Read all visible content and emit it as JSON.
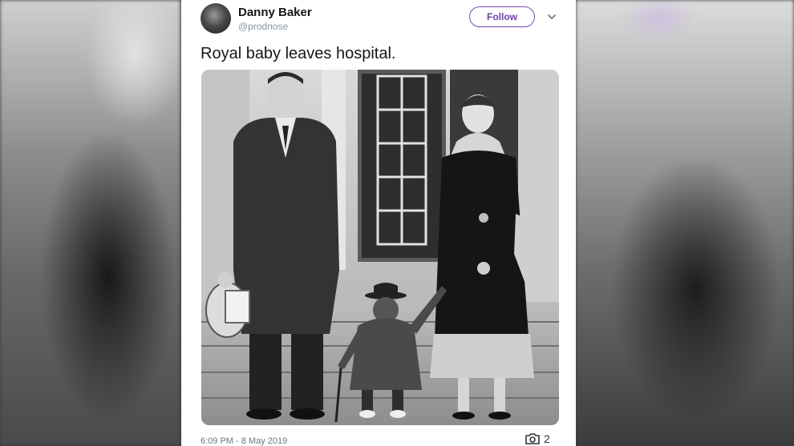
{
  "tweet": {
    "author": {
      "display_name": "Danny Baker",
      "handle": "@prodnose"
    },
    "follow_label": "Follow",
    "text": "Royal baby leaves hospital.",
    "timestamp": "6:09 PM - 8 May 2019",
    "photo_count": "2",
    "icons": {
      "more": "chevron-down-icon",
      "photos": "camera-icon"
    },
    "colors": {
      "follow_accent": "#7b4bb5",
      "text": "#14171a",
      "muted": "#8a959e"
    }
  }
}
